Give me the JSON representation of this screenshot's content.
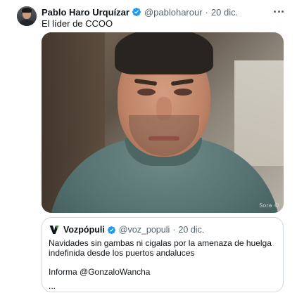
{
  "tweet": {
    "author_name": "Pablo Haro Urquízar",
    "author_handle": "@pabloharour",
    "separator": "·",
    "date": "20 dic.",
    "text": "El líder de CCOO",
    "more_icon": "more-horizontal-icon",
    "verified_icon": "verified-badge-icon",
    "verified_color": "#1d9bf0"
  },
  "media": {
    "watermark": "Sora ©"
  },
  "quoted_tweet": {
    "author_name": "Vozpópuli",
    "author_handle": "@voz_populi",
    "separator": "·",
    "date": "20 dic.",
    "logo_icon": "vozpopuli-logo-icon",
    "logo_color": "#5a8f2a",
    "text_line1": "Navidades sin gambas ni cigalas por la amenaza de huelga indefinida desde los puertos andaluces",
    "text_line2": "Informa @GonzaloWancha",
    "text_line3": "..."
  }
}
